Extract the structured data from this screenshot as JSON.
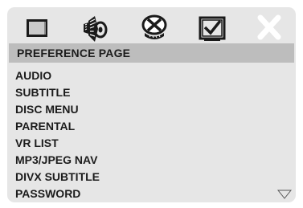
{
  "icons": [
    {
      "name": "general-setup-icon",
      "selected": false
    },
    {
      "name": "audio-setup-icon",
      "selected": false
    },
    {
      "name": "video-setup-icon",
      "selected": false
    },
    {
      "name": "preference-icon",
      "selected": true
    },
    {
      "name": "exit-icon",
      "selected": false
    }
  ],
  "page_title": "PREFERENCE PAGE",
  "menu": {
    "items": [
      "AUDIO",
      "SUBTITLE",
      "DISC MENU",
      "PARENTAL",
      "VR LIST",
      "MP3/JPEG NAV",
      "DIVX SUBTITLE",
      "PASSWORD"
    ]
  },
  "scroll_down_icon": "triangle-down-icon",
  "colors": {
    "panel": "#e6e6e6",
    "title_bar": "#bdbdbd",
    "text": "#1c1c1c"
  }
}
